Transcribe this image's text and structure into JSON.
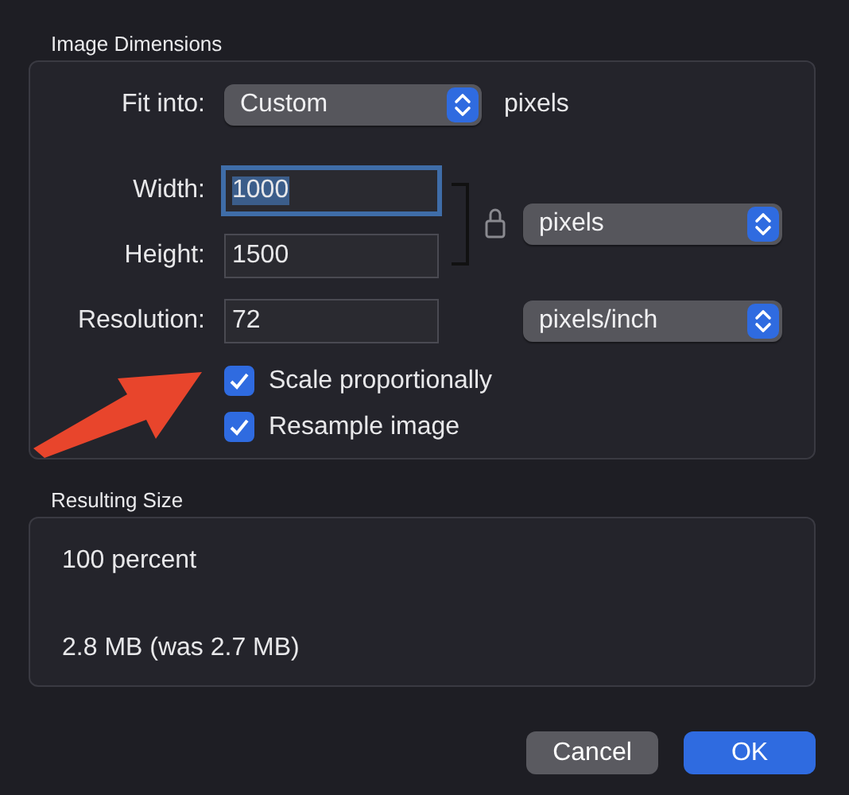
{
  "image_dimensions": {
    "title": "Image Dimensions",
    "fit_into": {
      "label": "Fit into:",
      "value": "Custom",
      "unit": "pixels"
    },
    "fields": [
      {
        "label": "Width:",
        "value": "1000",
        "focused": true
      },
      {
        "label": "Height:",
        "value": "1500",
        "focused": false
      },
      {
        "label": "Resolution:",
        "value": "72",
        "focused": false
      }
    ],
    "size_unit": "pixels",
    "resolution_unit": "pixels/inch",
    "checkboxes": [
      {
        "label": "Scale proportionally",
        "checked": true
      },
      {
        "label": "Resample image",
        "checked": true
      }
    ]
  },
  "resulting_size": {
    "title": "Resulting Size",
    "lines": [
      "100 percent",
      "2.8 MB (was 2.7 MB)"
    ]
  },
  "buttons": [
    {
      "label": "Cancel",
      "default": false
    },
    {
      "label": "OK",
      "default": true
    }
  ]
}
